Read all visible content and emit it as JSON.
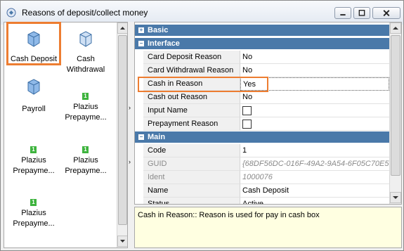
{
  "window": {
    "title": "Reasons of deposit/collect money"
  },
  "colors": {
    "highlight": "#ed7d31",
    "category_header": "#4a79a9",
    "description_bg": "#ffffe1"
  },
  "icons": {
    "title": "window-app-icon",
    "tile": "cube-icon",
    "new_badge": "green-one-badge"
  },
  "tiles": [
    {
      "label": "Cash Deposit",
      "icon": "cube-icon",
      "badge": ""
    },
    {
      "label": "Cash Withdrawal",
      "icon": "cube-icon",
      "badge": ""
    },
    {
      "label": "Payroll",
      "icon": "cube-icon",
      "badge": ""
    },
    {
      "label": "Plazius Prepayme...",
      "icon": "badge",
      "badge": "1"
    },
    {
      "label": "Plazius Prepayme...",
      "icon": "badge",
      "badge": "1"
    },
    {
      "label": "Plazius Prepayme...",
      "icon": "badge",
      "badge": "1"
    },
    {
      "label": "Plazius Prepayme...",
      "icon": "badge",
      "badge": "1"
    }
  ],
  "grid": {
    "categories": {
      "basic": "Basic",
      "interface": "Interface",
      "main": "Main"
    },
    "interface_rows": [
      {
        "name": "Card Deposit Reason",
        "value": "No"
      },
      {
        "name": "Card Withdrawal Reason",
        "value": "No"
      },
      {
        "name": "Cash in Reason",
        "value": "Yes"
      },
      {
        "name": "Cash out Reason",
        "value": "No"
      },
      {
        "name": "Input Name",
        "value": ""
      },
      {
        "name": "Prepayment Reason",
        "value": ""
      }
    ],
    "main_rows": [
      {
        "name": "Code",
        "value": "1"
      },
      {
        "name": "GUID",
        "value": "{68DF56DC-016F-49A2-9A54-6F05C70E5"
      },
      {
        "name": "Ident",
        "value": "1000076"
      },
      {
        "name": "Name",
        "value": "Cash Deposit"
      },
      {
        "name": "Status",
        "value": "Active"
      }
    ]
  },
  "description": "Cash in Reason:: Reason is used for pay in cash box"
}
